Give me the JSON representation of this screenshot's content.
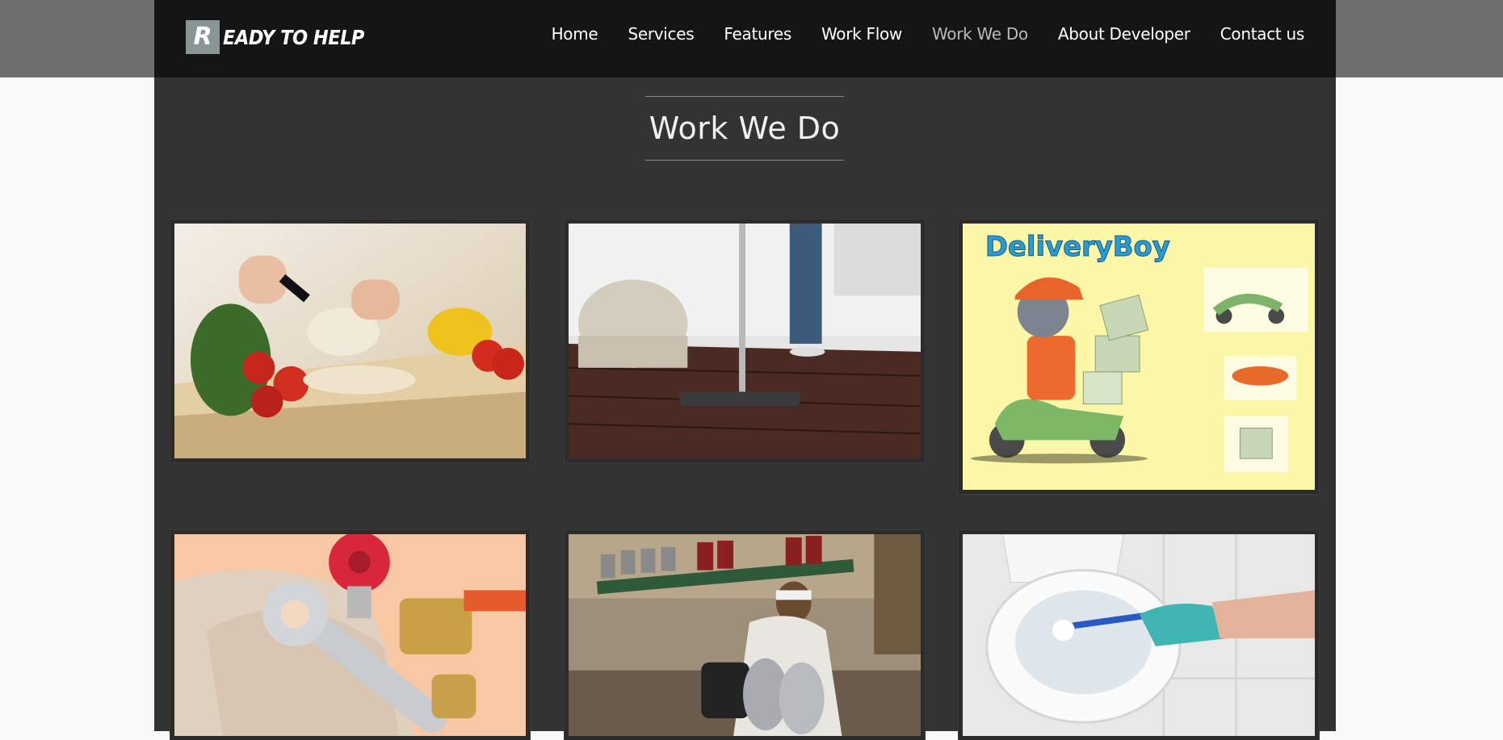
{
  "logo": {
    "initial": "R",
    "text": "EADY TO HELP"
  },
  "nav": {
    "items": [
      {
        "label": "Home",
        "active": false
      },
      {
        "label": "Services",
        "active": false
      },
      {
        "label": "Features",
        "active": false
      },
      {
        "label": "Work Flow",
        "active": false
      },
      {
        "label": "Work We Do",
        "active": true
      },
      {
        "label": "About Developer",
        "active": false
      },
      {
        "label": "Contact us",
        "active": false
      }
    ]
  },
  "section": {
    "title": "Work We Do"
  },
  "gallery": {
    "items": [
      {
        "name": "cooking"
      },
      {
        "name": "cleaning"
      },
      {
        "name": "delivery",
        "title": "DeliveryBoy"
      },
      {
        "name": "plumbing"
      },
      {
        "name": "tiffin-delivery"
      },
      {
        "name": "toilet-cleaning"
      }
    ]
  },
  "colors": {
    "navbar": "#151515",
    "body_panel": "#333333",
    "page_bg": "#f9f9f9",
    "active_nav": "#b9b9b9"
  }
}
